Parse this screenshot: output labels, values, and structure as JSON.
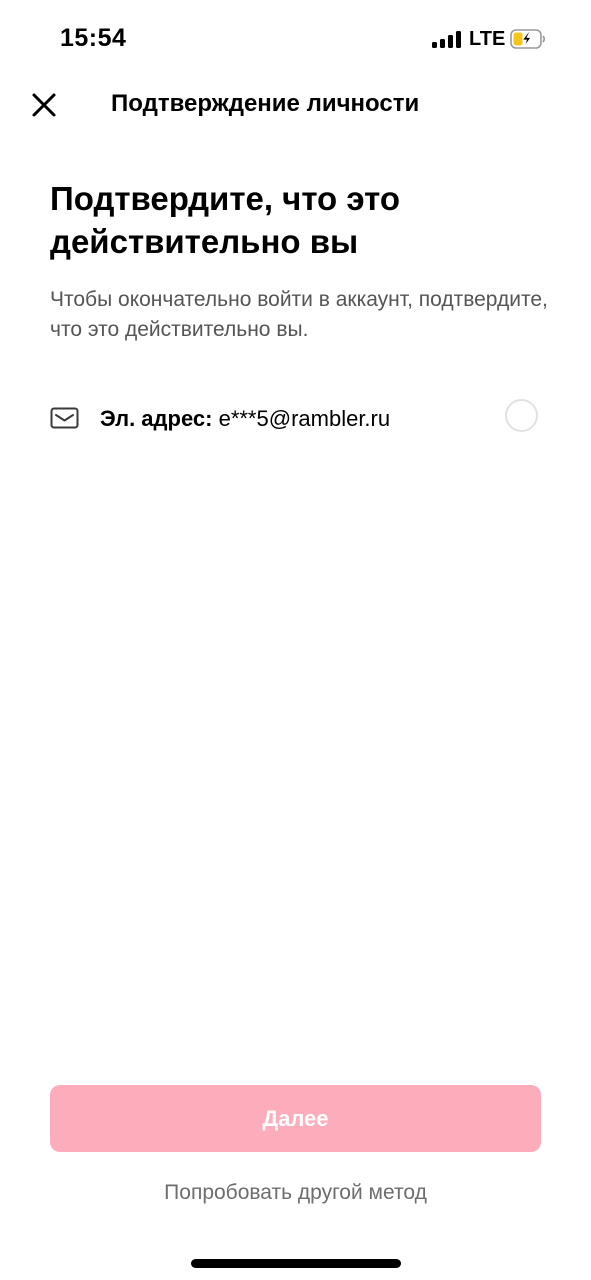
{
  "status_bar": {
    "time": "15:54",
    "network": "LTE",
    "battery_color": "#f5c518"
  },
  "nav": {
    "close_icon": "close-icon",
    "title": "Подтверждение личности"
  },
  "main": {
    "heading": "Подтвердите, что это действительно вы",
    "subtitle": "Чтобы окончательно войти в аккаунт, подтвердите, что это действительно вы."
  },
  "method": {
    "icon": "envelope-icon",
    "label": "Эл. адрес:",
    "value": "e***5@rambler.ru",
    "selected": false
  },
  "footer": {
    "next_label": "Далее",
    "other_method_label": "Попробовать другой метод"
  },
  "colors": {
    "accent_disabled": "#fdacbb",
    "secondary_text": "#555555"
  }
}
